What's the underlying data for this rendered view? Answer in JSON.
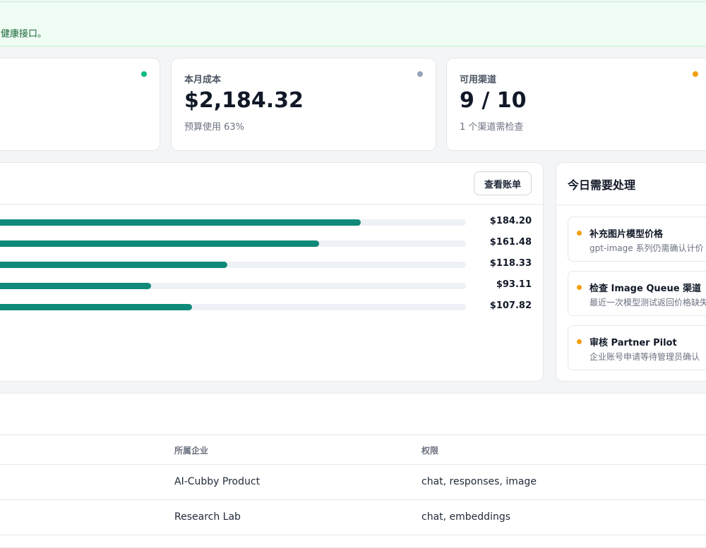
{
  "banner": {
    "text": "健康接口。"
  },
  "stats": [
    {
      "label": "",
      "value": "",
      "sub": "",
      "dot_color": "#10b981"
    },
    {
      "label": "本月成本",
      "value": "$2,184.32",
      "sub": "预算使用 63%",
      "dot_color": "#94a3b8"
    },
    {
      "label": "可用渠道",
      "value": "9 / 10",
      "sub": "1 个渠道需检查",
      "dot_color": "#f59e0b"
    }
  ],
  "cost_panel": {
    "bill_button": "查看账单",
    "bars": [
      {
        "value": "$184.20",
        "fill": 0.78
      },
      {
        "value": "$161.48",
        "fill": 0.693
      },
      {
        "value": "$118.33",
        "fill": 0.502
      },
      {
        "value": "$93.11",
        "fill": 0.343
      },
      {
        "value": "$107.82",
        "fill": 0.428
      }
    ]
  },
  "todo": {
    "title": "今日需要处理",
    "items": [
      {
        "title": "补充图片模型价格",
        "desc": "gpt-image 系列仍需确认计价"
      },
      {
        "title": "检查 Image Queue 渠道",
        "desc": "最近一次模型测试返回价格缺失"
      },
      {
        "title": "审核 Partner Pilot",
        "desc": "企业账号申请等待管理员确认"
      }
    ]
  },
  "keys_table": {
    "columns": [
      "所属企业",
      "权限"
    ],
    "rows": [
      {
        "enterprise": "AI-Cubby Product",
        "permissions": "chat, responses, image"
      },
      {
        "enterprise": "Research Lab",
        "permissions": "chat, embeddings"
      }
    ]
  },
  "colors": {
    "accent": "#0f8a7a",
    "warning": "#f59e0b",
    "success": "#10b981"
  }
}
